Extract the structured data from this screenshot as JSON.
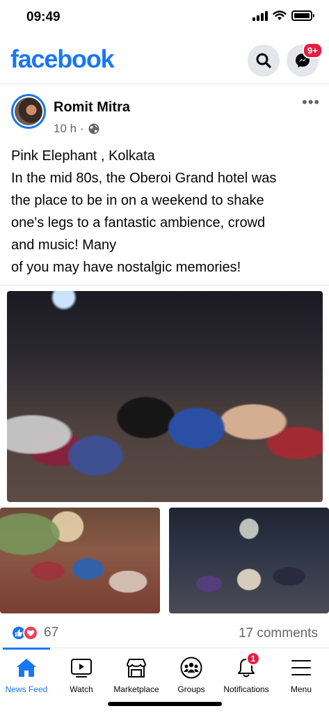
{
  "status_bar": {
    "time": "09:49"
  },
  "header": {
    "logo": "facebook",
    "search_icon": "search-icon",
    "messenger_icon": "messenger-icon",
    "messenger_badge": "9+",
    "brand_color": "#1877f2"
  },
  "post": {
    "author": "Romit Mitra",
    "time": "10 h",
    "separator": "·",
    "audience_icon": "globe-icon",
    "more": "•••",
    "text_lines": [
      "Pink Elephant , Kolkata",
      "In the mid 80s, the Oberoi Grand  hotel was",
      "the place  to be  in on a weekend  to shake",
      "one's  legs to a fantastic  ambience, crowd",
      "and  music!  Many",
      "of you  may have nostalgic  memories!"
    ],
    "reaction_count": "67",
    "comments": "17 comments"
  },
  "nav": {
    "items": [
      {
        "label": "News Feed",
        "icon": "home-icon",
        "active": true
      },
      {
        "label": "Watch",
        "icon": "watch-icon",
        "active": false
      },
      {
        "label": "Marketplace",
        "icon": "marketplace-icon",
        "active": false
      },
      {
        "label": "Groups",
        "icon": "groups-icon",
        "active": false
      },
      {
        "label": "Notifications",
        "icon": "bell-icon",
        "active": false,
        "badge": "1"
      },
      {
        "label": "Menu",
        "icon": "menu-icon",
        "active": false
      }
    ]
  }
}
